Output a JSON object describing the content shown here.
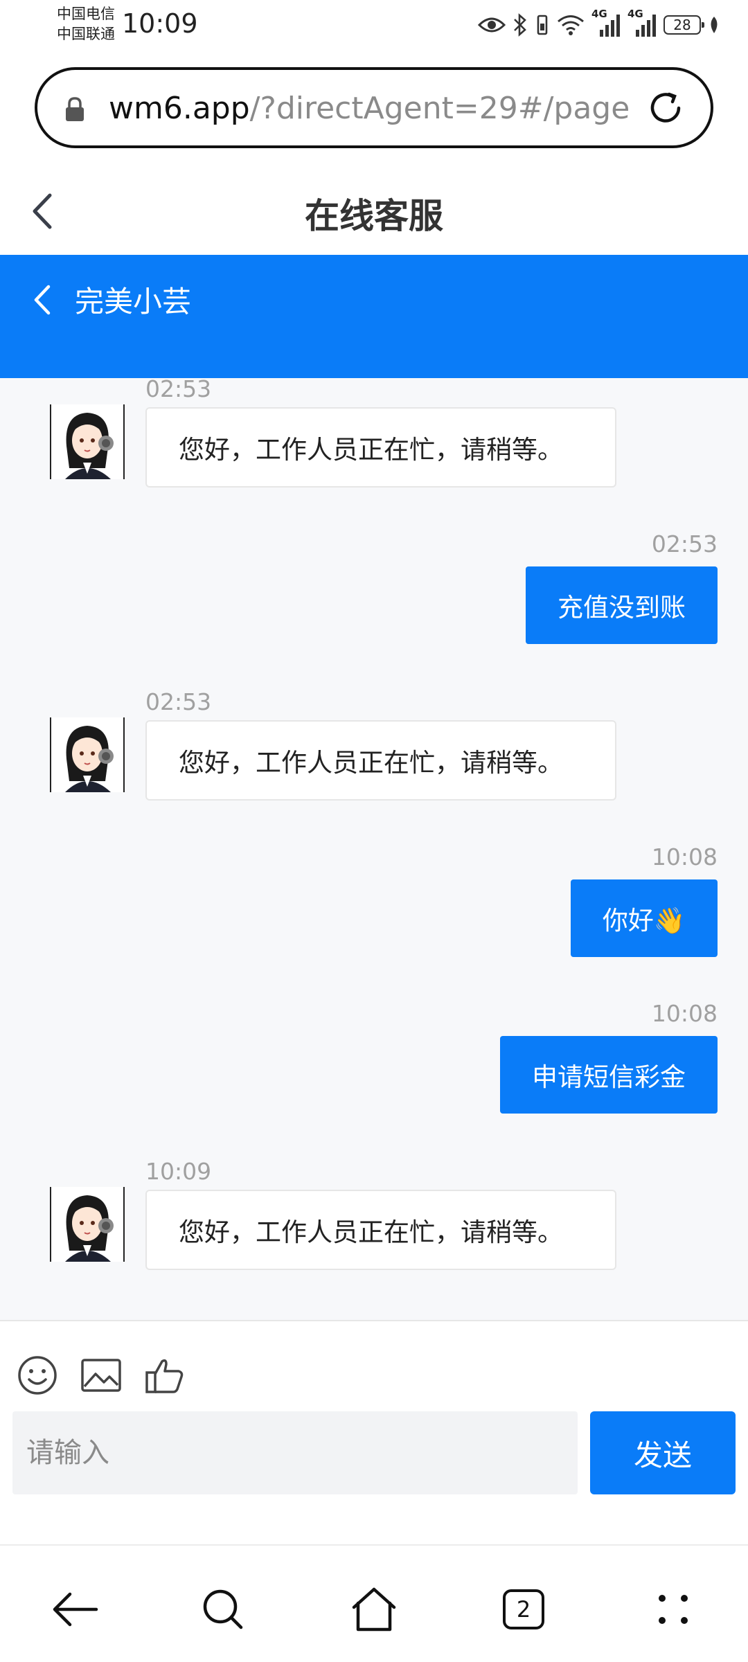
{
  "status": {
    "carrier_1": "中国电信",
    "carrier_2": "中国联通",
    "time": "10:09",
    "battery": "28",
    "network_1": "4G",
    "network_2": "4G"
  },
  "browser": {
    "url_host": "wm6.app",
    "url_path": "/?directAgent=29#/page",
    "tab_count": "2"
  },
  "page": {
    "title": "在线客服"
  },
  "agent": {
    "name": "完美小芸"
  },
  "messages": [
    {
      "side": "left",
      "time": "02:53",
      "text": "您好，工作人员正在忙，请稍等。"
    },
    {
      "side": "right",
      "time": "02:53",
      "text": "充值没到账"
    },
    {
      "side": "left",
      "time": "02:53",
      "text": "您好，工作人员正在忙，请稍等。"
    },
    {
      "side": "right",
      "time": "10:08",
      "text": "你好👋"
    },
    {
      "side": "right",
      "time": "10:08",
      "text": "申请短信彩金"
    },
    {
      "side": "left",
      "time": "10:09",
      "text": "您好，工作人员正在忙，请稍等。"
    }
  ],
  "composer": {
    "placeholder": "请输入",
    "send_label": "发送"
  },
  "colors": {
    "accent": "#0a7cf8",
    "chat_bg": "#f7f8fa"
  },
  "icons": {
    "emoji": "smile-icon",
    "image": "image-icon",
    "like": "thumbs-up-icon"
  }
}
